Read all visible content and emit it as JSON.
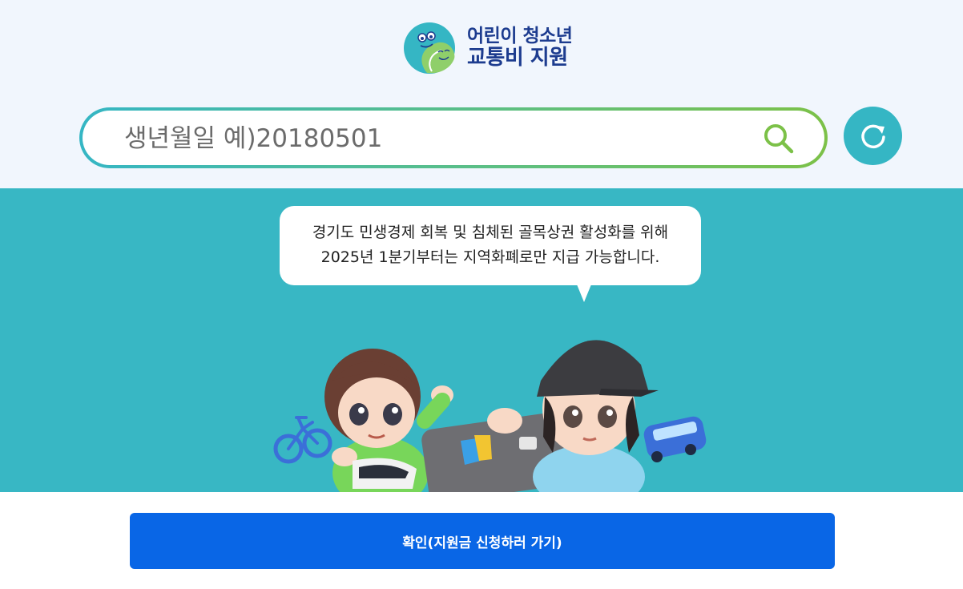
{
  "logo": {
    "line1": "어린이 청소년",
    "line2": "교통비 지원",
    "icon": "smiling-faces-logo-icon"
  },
  "search": {
    "placeholder": "생년월일 예)20180501",
    "value": "",
    "icon": "search-icon",
    "refresh_icon": "refresh-icon"
  },
  "notice": {
    "line1": "경기도 민생경제 회복 및 침체된 골목상권 활성화를 위해",
    "line2": "2025년 1분기부터는 지역화폐로만 지급 가능합니다."
  },
  "confirm_button": {
    "label": "확인(지원금 신청하러 가기)"
  },
  "colors": {
    "teal": "#38b7c4",
    "navy": "#1d3c8f",
    "green": "#7cc148",
    "button_blue": "#0966e6",
    "top_bg": "#f1f6fd"
  }
}
